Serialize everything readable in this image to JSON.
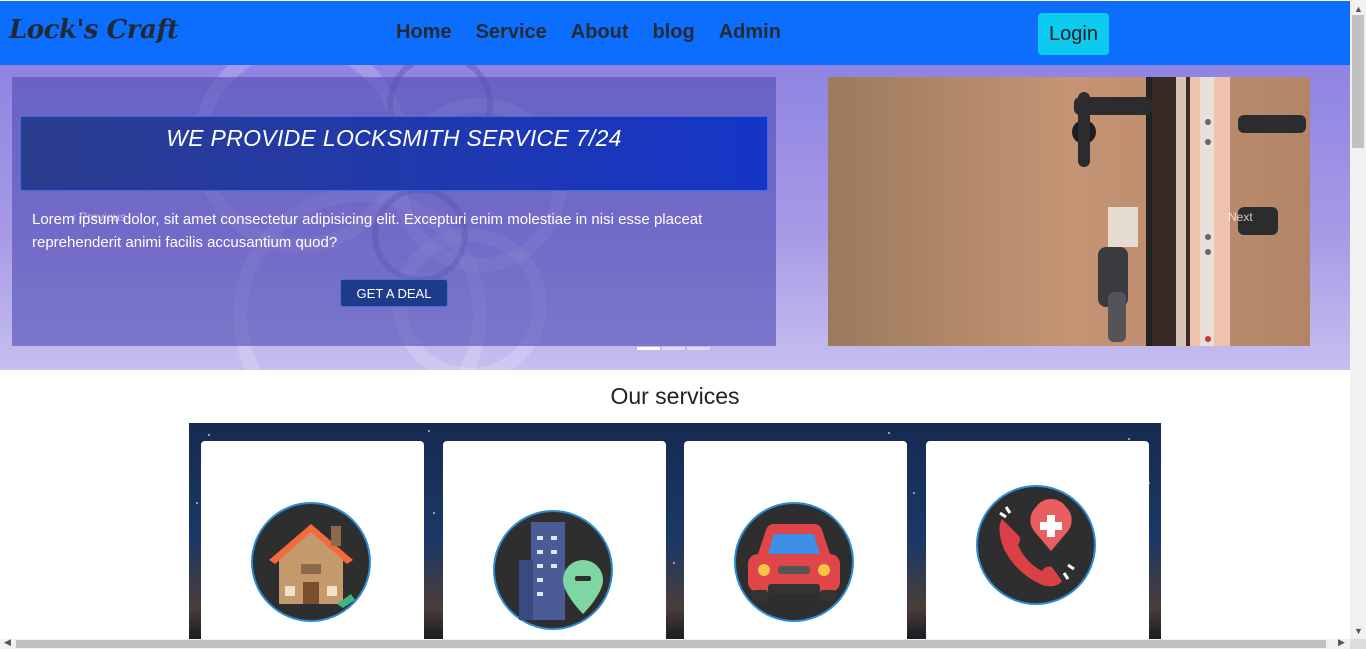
{
  "navbar": {
    "brand": "Lock's Craft",
    "links": [
      "Home",
      "Service",
      "About",
      "blog",
      "Admin"
    ],
    "login_label": "Login",
    "color": "#0d6efd",
    "login_color": "#0dcaf0"
  },
  "hero": {
    "title": "WE PROVIDE LOCKSMITH SERVICE 7/24",
    "text": "Lorem ipsum dolor, sit amet consectetur adipisicing elit. Excepturi enim molestiae in nisi esse placeat reprehenderit animi facilis accusantium quod?",
    "cta_label": "GET A DEAL",
    "prev_label": "Previous",
    "next_label": "Next",
    "slides": 3,
    "active_slide": 1
  },
  "services": {
    "title": "Our services",
    "icons": [
      "house-icon",
      "building-location-icon",
      "car-icon",
      "emergency-phone-icon"
    ]
  }
}
